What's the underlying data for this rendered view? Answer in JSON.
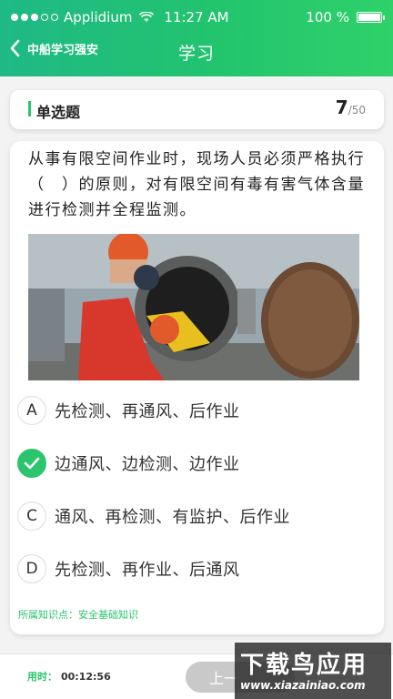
{
  "status_bar": {
    "carrier": "Applidium",
    "time": "11:27 AM",
    "battery": "100 %"
  },
  "nav": {
    "back_label": "中船学习强安",
    "title": "学习"
  },
  "question_header": {
    "type": "单选题",
    "current": "7",
    "total": "/50"
  },
  "question": {
    "text": "从事有限空间作业时，现场人员必须严格执行（　）的原则，对有限空间有毒有害气体含量进行检测并全程监测。",
    "options": [
      {
        "letter": "A",
        "text": "先检测、再通风、后作业",
        "state": "normal"
      },
      {
        "letter": "",
        "text": "边通风、边检测、边作业",
        "state": "correct"
      },
      {
        "letter": "C",
        "text": "通风、再检测、有监护、后作业",
        "state": "normal"
      },
      {
        "letter": "D",
        "text": "先检测、再作业、后通风",
        "state": "normal"
      }
    ],
    "knowledge_label": "所属知识点：",
    "knowledge_value": "安全基础知识"
  },
  "footer": {
    "timer_label": "用时：",
    "timer_value": "00:12:56",
    "prev_button": "上一"
  },
  "watermark": {
    "title": "下载鸟应用",
    "url": "www.xiazainiao.com"
  },
  "colors": {
    "accent": "#2cc56d",
    "header_gradient_start": "#1fb986",
    "header_gradient_end": "#2fd16a"
  }
}
